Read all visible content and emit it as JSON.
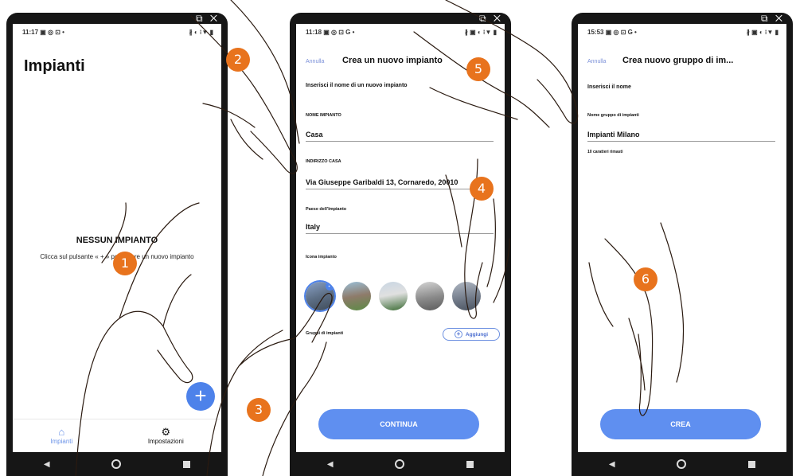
{
  "phones": [
    {
      "status": {
        "time": "11:17",
        "left_icons": "▣ ◎ ⊡ •",
        "right_icons": "∦ ◐ ⁝▼ ▮"
      },
      "title": "Impianti",
      "empty_title": "NESSUN IMPIANTO",
      "empty_sub": "Clicca sul pulsante « + » per creare un nuovo impianto",
      "fab_label": "+",
      "tabs": [
        {
          "label": "Impianti",
          "icon": "⌂"
        },
        {
          "label": "Impostazioni",
          "icon": "⚙"
        }
      ]
    },
    {
      "status": {
        "time": "11:18",
        "left_icons": "▣ ◎ ⊡ G •",
        "right_icons": "∦ ▣ ◐ ⁝▼ ▮"
      },
      "cancel": "Annulla",
      "title": "Crea un nuovo impianto",
      "prompt": "Inserisci il nome di un nuovo impianto",
      "name_label": "NOME IMPIANTO",
      "name_value": "Casa",
      "address_label": "INDIRIZZO CASA",
      "address_value": "Via Giuseppe Garibaldi 13, Cornaredo, 20010",
      "country_label": "Paese dell'Impianto",
      "country_value": "Italy",
      "icon_label": "Icona impianto",
      "group_label": "Gruppi di impianti",
      "add_label": "Aggiungi",
      "continue_label": "CONTINUA"
    },
    {
      "status": {
        "time": "15:53",
        "left_icons": "▣ ◎ ⊡ G •",
        "right_icons": "∦ ▣ ◐ ⁝▼ ▮"
      },
      "cancel": "Annulla",
      "title": "Crea nuovo gruppo di im...",
      "prompt": "Inserisci il nome",
      "name_label": "Nome gruppo di impianti",
      "name_value": "Impianti Milano",
      "hint": "10 caratteri rimasti",
      "create_label": "CREA"
    }
  ],
  "window_icons": "⧉ ✕",
  "nav": {
    "back": "◀"
  },
  "step_badges": [
    "1",
    "2",
    "3",
    "4",
    "5",
    "6"
  ],
  "colors": {
    "badge": "#e8731d",
    "accent": "#5f8ff0",
    "phone_frame": "#161616"
  }
}
